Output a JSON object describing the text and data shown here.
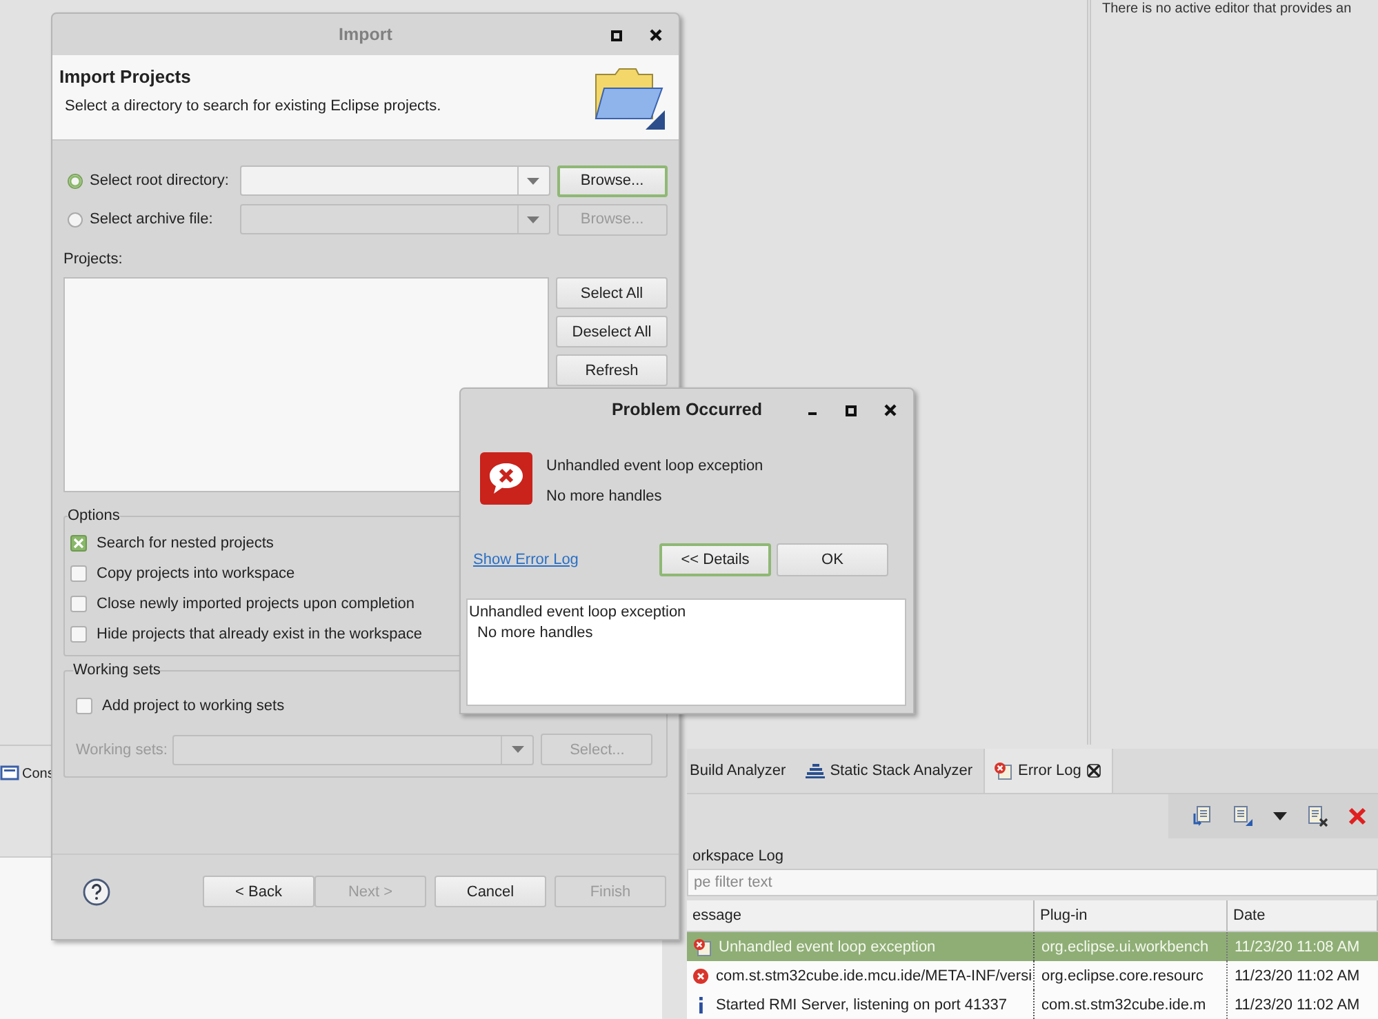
{
  "ide": {
    "outline_message": "There is no active editor that provides an",
    "left_tabs": [
      {
        "label": "Cons",
        "selected": false
      }
    ],
    "error_log": {
      "tabs": [
        {
          "label": "Build Analyzer",
          "kind": "plain",
          "selected": false,
          "closable": false
        },
        {
          "label": "Static Stack Analyzer",
          "kind": "stack",
          "selected": false,
          "closable": false
        },
        {
          "label": "Error Log",
          "kind": "log",
          "selected": true,
          "closable": true
        }
      ],
      "title": "orkspace Log",
      "filter": {
        "placeholder": "pe filter text"
      },
      "columns": [
        "essage",
        "Plug-in",
        "Date"
      ],
      "rows": [
        {
          "kind": "error_log",
          "message": "Unhandled event loop exception",
          "plugin": "org.eclipse.ui.workbench",
          "date": "11/23/20 11:08 AM",
          "selected": true
        },
        {
          "kind": "error",
          "message": "com.st.stm32cube.ide.mcu.ide/META-INF/versi",
          "plugin": "org.eclipse.core.resourc",
          "date": "11/23/20 11:02 AM",
          "selected": false
        },
        {
          "kind": "info",
          "message": "Started RMI Server, listening on port 41337",
          "plugin": "com.st.stm32cube.ide.m",
          "date": "11/23/20 11:02 AM",
          "selected": false
        }
      ]
    }
  },
  "import_dialog": {
    "title": "Import",
    "header": "Import Projects",
    "description": "Select a directory to search for existing Eclipse projects.",
    "sources": [
      {
        "label": "Select root directory:",
        "selected": true,
        "button": "Browse...",
        "disabled": false,
        "focused": true
      },
      {
        "label": "Select archive file:",
        "selected": false,
        "button": "Browse...",
        "disabled": true,
        "focused": false
      }
    ],
    "projects_label": "Projects:",
    "list_buttons": [
      "Select All",
      "Deselect All",
      "Refresh"
    ],
    "options": {
      "title": "Options",
      "items": [
        {
          "label": "Search for nested projects",
          "checked": true
        },
        {
          "label": "Copy projects into workspace",
          "checked": false
        },
        {
          "label": "Close newly imported projects upon completion",
          "checked": false
        },
        {
          "label": "Hide projects that already exist in the workspace",
          "checked": false
        }
      ]
    },
    "working_sets": {
      "title": "Working sets",
      "add": {
        "label": "Add project to working sets",
        "checked": false
      },
      "label": "Working sets:",
      "button": "Select...",
      "disabled": true
    },
    "footer_buttons": [
      {
        "label": "< Back",
        "disabled": false
      },
      {
        "label": "Next >",
        "disabled": true
      },
      {
        "label": "Cancel",
        "disabled": false
      },
      {
        "label": "Finish",
        "disabled": true
      }
    ]
  },
  "problem_dialog": {
    "title": "Problem Occurred",
    "message": "Unhandled event loop exception",
    "detail": "No more handles",
    "link": "Show Error Log",
    "buttons": [
      {
        "label": "<< Details",
        "default": true
      },
      {
        "label": "OK",
        "default": false
      }
    ],
    "details_lines": [
      "Unhandled event loop exception",
      "No more handles"
    ]
  }
}
